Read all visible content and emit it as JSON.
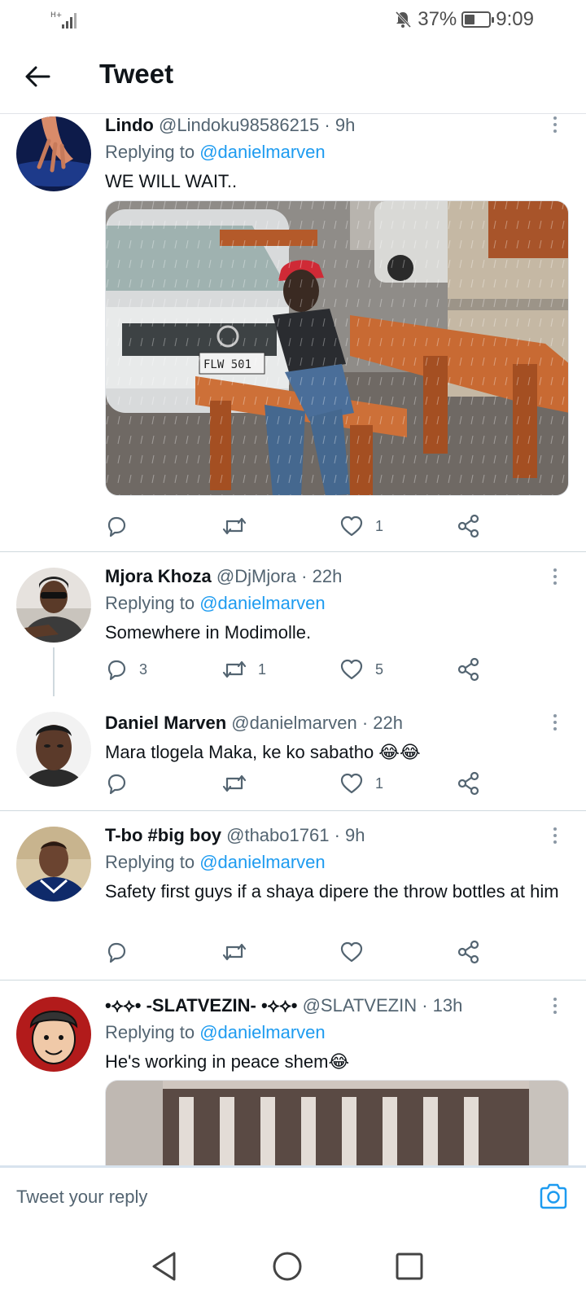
{
  "status_bar": {
    "network": "H+",
    "battery": "37%",
    "time": "9:09"
  },
  "header": {
    "title": "Tweet"
  },
  "tweets": [
    {
      "name": "Lindo",
      "handle": "@Lindoku98586215",
      "time": "· 9h",
      "replying_label": "Replying to",
      "replying_to": "@danielmarven",
      "text": "WE WILL WAIT..",
      "has_media": true,
      "replies": "",
      "retweets": "",
      "likes": "1"
    },
    {
      "name": "Mjora Khoza",
      "handle": "@DjMjora",
      "time": "· 22h",
      "replying_label": "Replying to",
      "replying_to": "@danielmarven",
      "text": "Somewhere in Modimolle.",
      "replies": "3",
      "retweets": "1",
      "likes": "5"
    },
    {
      "name": "Daniel Marven",
      "handle": "@danielmarven",
      "time": "· 22h",
      "text": "Mara tlogela Maka, ke ko sabatho 😂😂",
      "replies": "",
      "retweets": "",
      "likes": "1"
    },
    {
      "name": "T-bo #big boy",
      "handle": "@thabo1761",
      "time": "· 9h",
      "replying_label": "Replying to",
      "replying_to": "@danielmarven",
      "text": "Safety first guys if a shaya dipere the throw bottles at him",
      "replies": "",
      "retweets": "",
      "likes": ""
    },
    {
      "name": "•⟡⟡• -SLATVEZIN- •⟡⟡•",
      "handle": "@SLATVEZIN",
      "time": "· 13h",
      "replying_label": "Replying to",
      "replying_to": "@danielmarven",
      "text": "He's working in peace shem😂",
      "has_media": true
    }
  ],
  "reply_bar": {
    "placeholder": "Tweet your reply"
  },
  "colors": {
    "accent": "#1d9bf0",
    "secondary_text": "#536471",
    "divider": "#cfd9de"
  },
  "icons": [
    "back-arrow-icon",
    "reply-icon",
    "retweet-icon",
    "like-icon",
    "share-icon",
    "more-icon",
    "camera-icon",
    "nav-back-icon",
    "nav-home-icon",
    "nav-recents-icon"
  ]
}
